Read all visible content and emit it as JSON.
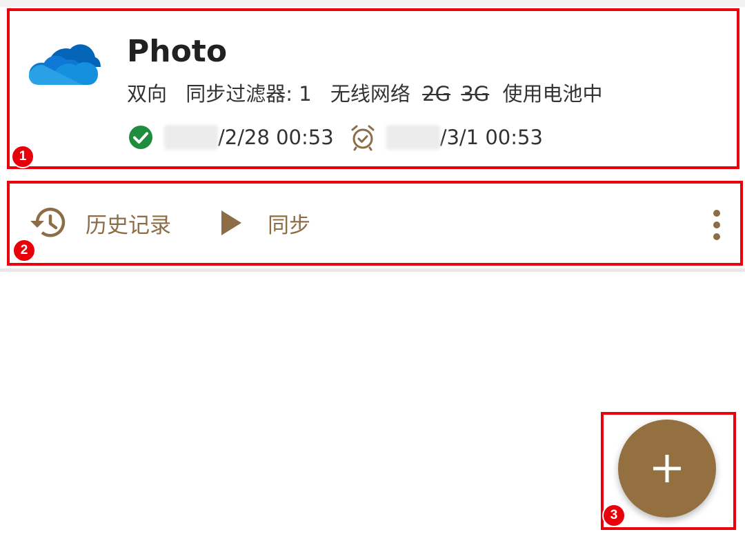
{
  "task": {
    "name": "Photo",
    "direction": "双向",
    "filter": "同步过滤器: 1",
    "network": "无线网络",
    "net_2g": "2G",
    "net_3g": "3G",
    "battery": "使用电池中",
    "last_sync_suffix": "/2/28 00:53",
    "next_sync_suffix": "/3/1 00:53",
    "last_sync_status": "success",
    "icon": "onedrive-cloud-icon"
  },
  "actions": {
    "history_label": "历史记录",
    "sync_label": "同步"
  },
  "annotations": {
    "one": "1",
    "two": "2",
    "three": "3"
  },
  "colors": {
    "accent": "#8c6d45",
    "fab": "#946f40",
    "success": "#1e8e3e",
    "annotation": "#e8000b"
  }
}
